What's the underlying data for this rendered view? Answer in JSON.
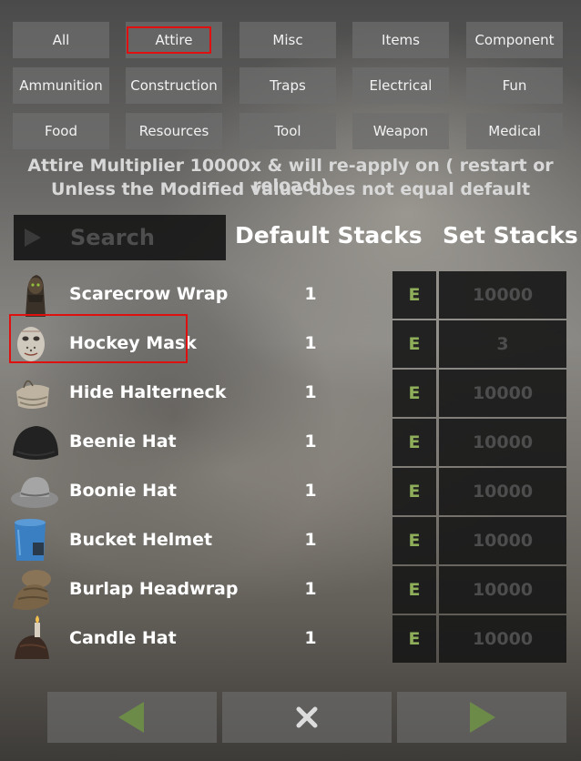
{
  "categories": [
    {
      "label": "All"
    },
    {
      "label": "Attire"
    },
    {
      "label": "Misc"
    },
    {
      "label": "Items"
    },
    {
      "label": "Component"
    },
    {
      "label": "Ammunition"
    },
    {
      "label": "Construction"
    },
    {
      "label": "Traps"
    },
    {
      "label": "Electrical"
    },
    {
      "label": "Fun"
    },
    {
      "label": "Food"
    },
    {
      "label": "Resources"
    },
    {
      "label": "Tool"
    },
    {
      "label": "Weapon"
    },
    {
      "label": "Medical"
    }
  ],
  "notice": {
    "line1": "Attire Multiplier 10000x & will re-apply on ( restart or reload )",
    "line2": "Unless the Modified value does not equal default"
  },
  "search": {
    "placeholder": "Search",
    "value": ""
  },
  "columns": {
    "default_stacks": "Default Stacks",
    "set_stacks": "Set Stacks"
  },
  "items": [
    {
      "name": "Scarecrow Wrap",
      "default": "1",
      "edit_label": "E",
      "set_value": "10000",
      "icon": "scarecrow-wrap-icon"
    },
    {
      "name": "Hockey Mask",
      "default": "1",
      "edit_label": "E",
      "set_value": "3",
      "icon": "hockey-mask-icon"
    },
    {
      "name": "Hide Halterneck",
      "default": "1",
      "edit_label": "E",
      "set_value": "10000",
      "icon": "hide-halterneck-icon"
    },
    {
      "name": "Beenie Hat",
      "default": "1",
      "edit_label": "E",
      "set_value": "10000",
      "icon": "beenie-hat-icon"
    },
    {
      "name": "Boonie Hat",
      "default": "1",
      "edit_label": "E",
      "set_value": "10000",
      "icon": "boonie-hat-icon"
    },
    {
      "name": "Bucket Helmet",
      "default": "1",
      "edit_label": "E",
      "set_value": "10000",
      "icon": "bucket-helmet-icon"
    },
    {
      "name": "Burlap Headwrap",
      "default": "1",
      "edit_label": "E",
      "set_value": "10000",
      "icon": "burlap-headwrap-icon"
    },
    {
      "name": "Candle Hat",
      "default": "1",
      "edit_label": "E",
      "set_value": "10000",
      "icon": "candle-hat-icon"
    }
  ],
  "nav": {
    "prev_icon": "arrow-left-icon",
    "close_icon": "close-icon",
    "next_icon": "arrow-right-icon"
  },
  "colors": {
    "accent_green": "#8fae5a",
    "highlight_red": "#e01010",
    "button_gray": "#6e6e6e",
    "field_dark": "#161616"
  }
}
